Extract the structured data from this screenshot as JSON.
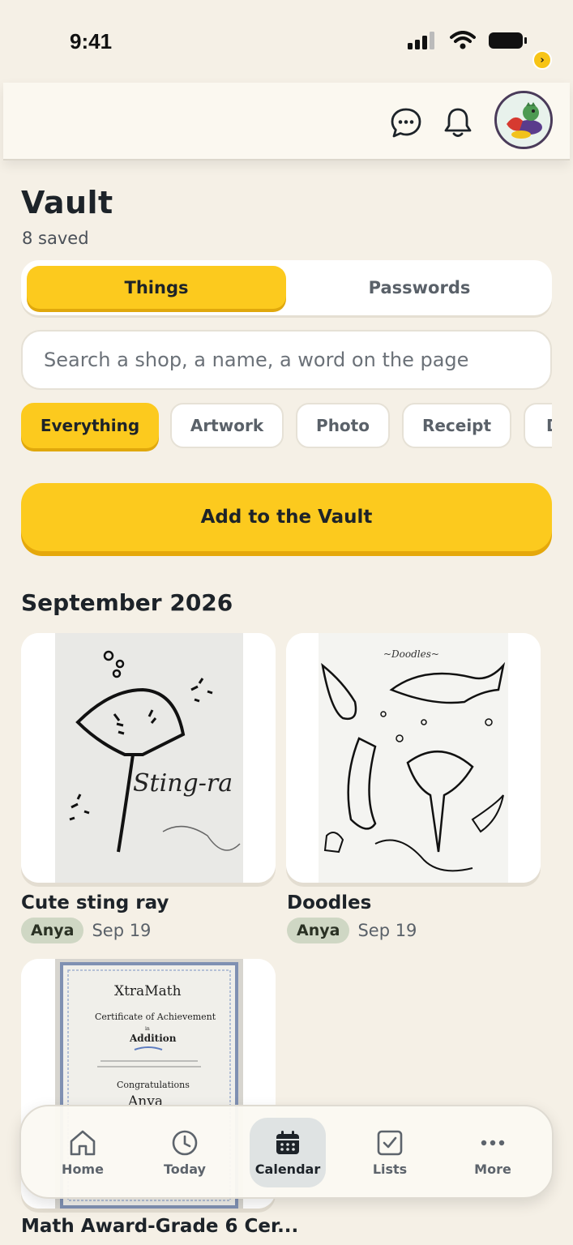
{
  "status": {
    "time": "9:41"
  },
  "header": {
    "chat_icon": "chat-bubble-icon",
    "bell_icon": "bell-icon",
    "avatar_badge": "›"
  },
  "vault": {
    "title": "Vault",
    "saved_count": "8 saved",
    "segments": [
      "Things",
      "Passwords"
    ],
    "search_placeholder": "Search a shop, a name, a word on the page",
    "filters": [
      "Everything",
      "Artwork",
      "Photo",
      "Receipt",
      "D"
    ],
    "add_button": "Add to the Vault",
    "section": "September 2026"
  },
  "cards": [
    {
      "title": "Cute sting ray",
      "person": "Anya",
      "date": "Sep 19",
      "image_text": "Sting-ra"
    },
    {
      "title": "Doodles",
      "person": "Anya",
      "date": "Sep 19",
      "image_text": "~Doodles~"
    },
    {
      "title": "Math Award-Grade 6 Cer...",
      "image_brand": "XtraMath",
      "image_line1": "Certificate of Achievement",
      "image_line2": "in",
      "image_line3": "Addition",
      "image_line4": "Congratulations",
      "image_line5": "Anya"
    }
  ],
  "tabs": [
    {
      "label": "Home",
      "icon": "home-icon"
    },
    {
      "label": "Today",
      "icon": "clock-icon"
    },
    {
      "label": "Calendar",
      "icon": "calendar-icon"
    },
    {
      "label": "Lists",
      "icon": "checkbox-icon"
    },
    {
      "label": "More",
      "icon": "more-icon"
    }
  ]
}
